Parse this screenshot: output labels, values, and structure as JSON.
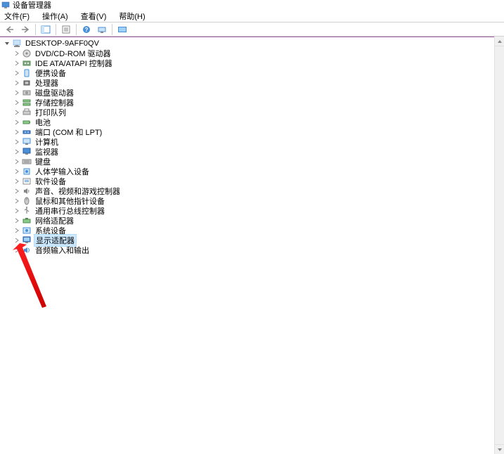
{
  "window": {
    "title": "设备管理器"
  },
  "menu": {
    "file": "文件(F)",
    "action": "操作(A)",
    "view": "查看(V)",
    "help": "帮助(H)"
  },
  "tree": {
    "root": "DESKTOP-9AFF0QV",
    "items": [
      {
        "label": "DVD/CD-ROM 驱动器",
        "icon": "disc"
      },
      {
        "label": "IDE ATA/ATAPI 控制器",
        "icon": "ide"
      },
      {
        "label": "便携设备",
        "icon": "portable"
      },
      {
        "label": "处理器",
        "icon": "cpu"
      },
      {
        "label": "磁盘驱动器",
        "icon": "disk"
      },
      {
        "label": "存储控制器",
        "icon": "storage"
      },
      {
        "label": "打印队列",
        "icon": "printer"
      },
      {
        "label": "电池",
        "icon": "battery"
      },
      {
        "label": "端口 (COM 和 LPT)",
        "icon": "port"
      },
      {
        "label": "计算机",
        "icon": "computer"
      },
      {
        "label": "监视器",
        "icon": "monitor"
      },
      {
        "label": "键盘",
        "icon": "keyboard"
      },
      {
        "label": "人体学输入设备",
        "icon": "hid"
      },
      {
        "label": "软件设备",
        "icon": "software"
      },
      {
        "label": "声音、视频和游戏控制器",
        "icon": "sound"
      },
      {
        "label": "鼠标和其他指针设备",
        "icon": "mouse"
      },
      {
        "label": "通用串行总线控制器",
        "icon": "usb"
      },
      {
        "label": "网络适配器",
        "icon": "network"
      },
      {
        "label": "系统设备",
        "icon": "system"
      },
      {
        "label": "显示适配器",
        "icon": "display",
        "selected": true
      },
      {
        "label": "音频输入和输出",
        "icon": "audio"
      }
    ]
  }
}
